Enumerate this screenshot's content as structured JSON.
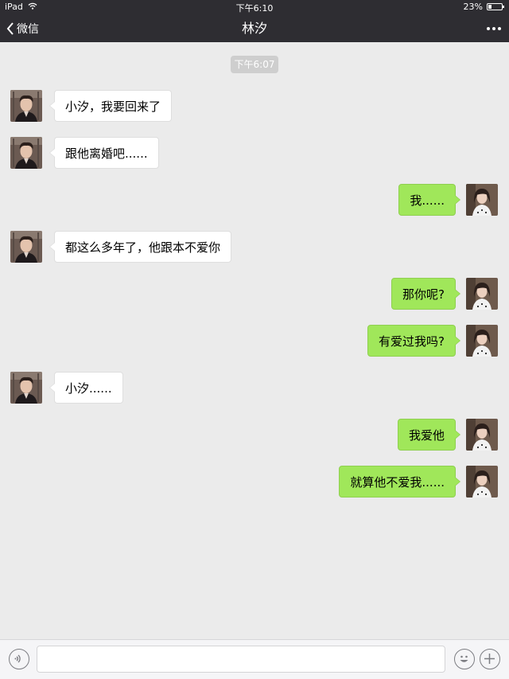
{
  "status_bar": {
    "device": "iPad",
    "time": "下午6:10",
    "battery": "23%",
    "battery_level": 0.23
  },
  "nav": {
    "back_label": "微信",
    "title": "林汐"
  },
  "chat": {
    "timestamp": "下午6:07",
    "messages": [
      {
        "side": "left",
        "text": "小汐，我要回来了"
      },
      {
        "side": "left",
        "text": "跟他离婚吧......"
      },
      {
        "side": "right",
        "text": "我......"
      },
      {
        "side": "left",
        "text": "都这么多年了，他跟本不爱你"
      },
      {
        "side": "right",
        "text": "那你呢?"
      },
      {
        "side": "right",
        "text": "有爱过我吗?"
      },
      {
        "side": "left",
        "text": "小汐......"
      },
      {
        "side": "right",
        "text": "我爱他"
      },
      {
        "side": "right",
        "text": "就算他不爱我......"
      }
    ]
  },
  "input": {
    "placeholder": ""
  },
  "colors": {
    "bar_dark": "#2e2d32",
    "chat_bg": "#ebebeb",
    "bubble_sent": "#a0e75a",
    "bubble_received": "#ffffff"
  }
}
